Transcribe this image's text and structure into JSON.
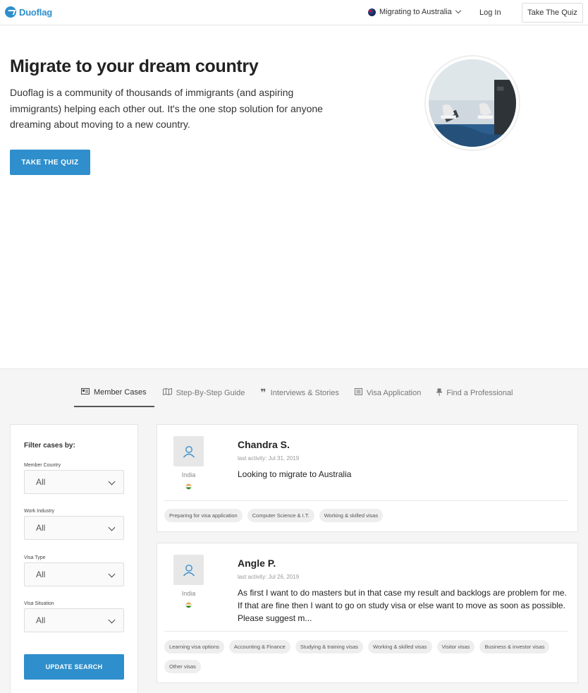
{
  "nav": {
    "logo_text": "Duoflag",
    "destination": "Migrating to Australia",
    "login": "Log In",
    "quiz_button": "Take The Quiz"
  },
  "hero": {
    "title": "Migrate to your dream country",
    "description": "Duoflag is a community of thousands of immigrants (and aspiring immigrants) helping each other out. It's the one stop solution for anyone dreaming about moving to a new country.",
    "cta": "TAKE THE QUIZ"
  },
  "tabs": [
    {
      "label": "Member Cases",
      "icon": "id-card-icon"
    },
    {
      "label": "Step-By-Step Guide",
      "icon": "map-icon"
    },
    {
      "label": "Interviews & Stories",
      "icon": "quote-icon"
    },
    {
      "label": "Visa Application",
      "icon": "list-icon"
    },
    {
      "label": "Find a Professional",
      "icon": "pin-icon"
    }
  ],
  "filter": {
    "title": "Filter cases by:",
    "groups": [
      {
        "label": "Member Country",
        "value": "All"
      },
      {
        "label": "Work Industry",
        "value": "All"
      },
      {
        "label": "Visa Type",
        "value": "All"
      },
      {
        "label": "Visa Situation",
        "value": "All"
      }
    ],
    "update_button": "UPDATE SEARCH"
  },
  "cases": [
    {
      "name": "Chandra S.",
      "activity": "last activity: Jul 31, 2019",
      "country": "India",
      "summary": "Looking to migrate to Australia",
      "tags": [
        "Preparing for visa application",
        "Computer Science & I.T.",
        "Working & skilled visas"
      ]
    },
    {
      "name": "Angle P.",
      "activity": "last activity: Jul 26, 2019",
      "country": "India",
      "summary": "As first I want to do masters but in that case my result and backlogs are problem for me. If that are fine then I want to go on study visa or else want to move as soon as possible. Please suggest m...",
      "tags": [
        "Learning visa options",
        "Accounting & Finance",
        "Studying & training visas",
        "Working & skilled visas",
        "Visitor visas",
        "Business & investor visas",
        "Other visas"
      ]
    }
  ],
  "colors": {
    "accent": "#2f8fcc",
    "section_bg": "#f5f5f5"
  }
}
